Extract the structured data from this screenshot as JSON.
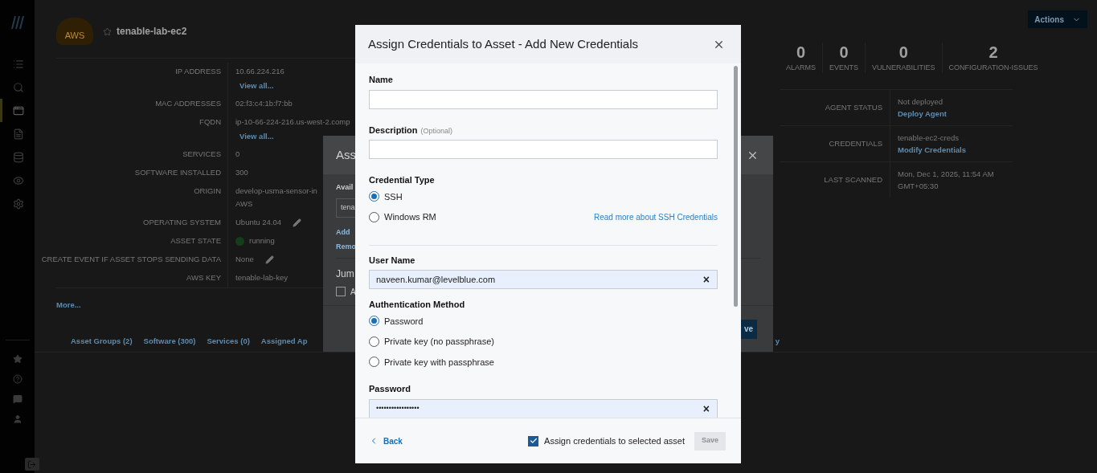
{
  "sidebar": {
    "top_items": [
      {
        "kind": "list",
        "selected": false
      },
      {
        "kind": "search",
        "selected": false
      },
      {
        "kind": "window",
        "selected": true
      },
      {
        "kind": "document",
        "selected": false
      },
      {
        "kind": "database",
        "selected": false
      },
      {
        "kind": "eye",
        "selected": false
      },
      {
        "kind": "gear",
        "selected": false
      }
    ],
    "bottom_items": [
      {
        "kind": "star"
      },
      {
        "kind": "help"
      },
      {
        "kind": "chat"
      },
      {
        "kind": "user"
      }
    ]
  },
  "asset": {
    "logo_text": "AWS",
    "title": "tenable-lab-ec2",
    "properties": [
      {
        "label": "IP ADDRESS",
        "lines": [
          "10.66.224.216"
        ],
        "link": "View all...",
        "editable": false
      },
      {
        "label": "MAC ADDRESSES",
        "lines": [
          "02:f3:c4:1b:f7:bb"
        ],
        "editable": false
      },
      {
        "label": "FQDN",
        "lines": [
          "ip-10-66-224-216.us-west-2.comp"
        ],
        "link": "View all...",
        "editable": false
      },
      {
        "label": "SERVICES",
        "lines": [
          "0"
        ],
        "editable": false
      },
      {
        "label": "SOFTWARE INSTALLED",
        "lines": [
          "300"
        ],
        "editable": false
      },
      {
        "label": "ORIGIN",
        "lines": [
          "develop-usma-sensor-in",
          "AWS"
        ],
        "editable": false
      },
      {
        "label": "OPERATING SYSTEM",
        "lines": [
          "Ubuntu 24.04"
        ],
        "editable": true
      },
      {
        "label": "ASSET STATE",
        "lines": [
          "running"
        ],
        "color": "#143d1a",
        "editable": false
      },
      {
        "label": "CREATE EVENT IF ASSET STOPS SENDING DATA",
        "lines": [
          "None"
        ],
        "editable": true
      },
      {
        "label": "AWS KEY",
        "lines": [
          "tenable-lab-key"
        ],
        "editable": false
      }
    ],
    "more_link": "More...",
    "tabs": [
      "Asset Groups (2)",
      "Software (300)",
      "Services (0)",
      "Assigned Ap"
    ],
    "last_tab": "y"
  },
  "actions_button": "Actions",
  "stats": [
    {
      "value": "0",
      "label": "ALARMS"
    },
    {
      "value": "0",
      "label": "EVENTS"
    },
    {
      "value": "0",
      "label": "VULNERABILITIES"
    },
    {
      "value": "2",
      "label": "CONFIGURATION-ISSUES"
    }
  ],
  "details": [
    {
      "label": "AGENT STATUS",
      "lines": [
        "Not deployed"
      ],
      "link": "Deploy Agent"
    },
    {
      "label": "CREDENTIALS",
      "lines": [
        "tenable-ec2-creds"
      ],
      "link": "Modify Credentials"
    },
    {
      "label": "LAST SCANNED",
      "lines": [
        "Mon, Dec 1, 2025, 11:54 AM",
        "GMT+05:30"
      ]
    }
  ],
  "back_dialog": {
    "title": "Ass",
    "section_label": "Avail",
    "select_value": "tena",
    "links": [
      "Add",
      "Remo"
    ],
    "section_2": "Jum",
    "checkbox": {
      "label": "A",
      "checked": false
    },
    "save_button": "ve"
  },
  "dialog": {
    "title": "Assign Credentials to Asset - Add New Credentials",
    "name": {
      "label": "Name"
    },
    "description": {
      "label": "Description",
      "hint": "(Optional)"
    },
    "credential_type": {
      "label": "Credential Type",
      "options": [
        {
          "label": "SSH",
          "selected": true
        },
        {
          "label": "Windows RM",
          "selected": false
        }
      ],
      "link": "Read more about SSH Credentials"
    },
    "user_name": {
      "label": "User Name",
      "value": "naveen.kumar@levelblue.com",
      "clear": "×"
    },
    "auth_method": {
      "label": "Authentication Method",
      "options": [
        {
          "label": "Password",
          "selected": true
        },
        {
          "label": "Private key (no passphrase)",
          "selected": false
        },
        {
          "label": "Private key with passphrase",
          "selected": false
        }
      ]
    },
    "password": {
      "label": "Password",
      "value": "•••••••••••••••••",
      "clear": "×"
    },
    "back": "Back",
    "assign_checkbox": {
      "label": "Assign credentials to selected asset",
      "checked": true
    },
    "save": {
      "label": "Save",
      "disabled": true
    }
  }
}
